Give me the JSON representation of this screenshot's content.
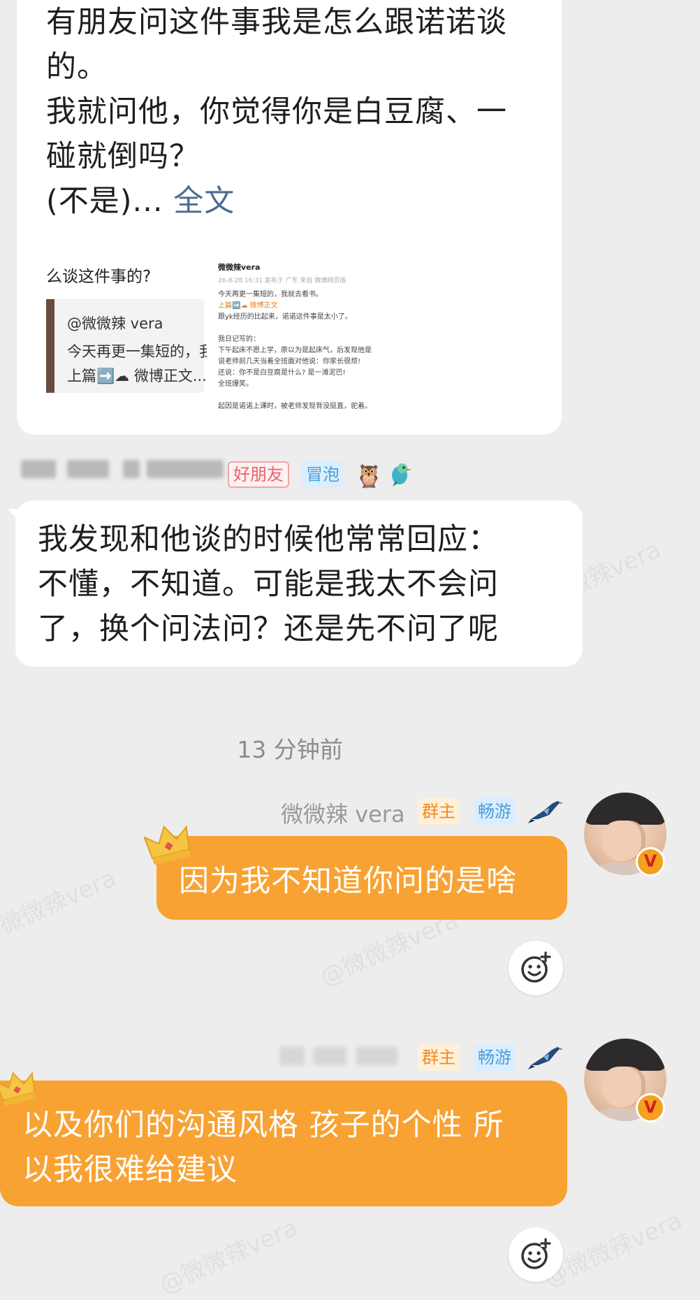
{
  "article_card": {
    "lines": [
      "有朋友问这件事我是怎么跟诺诺谈",
      "的。",
      "我就问他，你觉得你是白豆腐、一",
      "碰就倒吗？"
    ],
    "last_line_prefix": "(不是)... ",
    "full_text_link": "全文",
    "preview_left": {
      "title": "么谈这件事的?",
      "author": "@微微辣 vera",
      "snippet_1": "今天再更一集短的，我",
      "snippet_2": "上篇➡️☁ 微博正文..."
    },
    "preview_right": {
      "name": "微微辣vera",
      "meta": "26-8-28 16:31 发布于 广东 来自 微博网页版",
      "lines": [
        "今天再更一集短的，我就去看书。",
        "上篇➡️☁ 微博正文",
        "跟yk经历的比起来，诺诺这件事是太小了。",
        "",
        "我日记写的：",
        "下午起床不愿上学，原以为是起床气，后发现他是",
        "说老师前几天当着全班面对他说：你家长很烦!",
        "还说：你不是白豆腐是什么? 是一滩泥巴!",
        "全班爆笑。",
        "",
        "起因是诺诺上课时，被老师发现背没挺直，驼着。"
      ]
    }
  },
  "sender_row": {
    "friend_tag": "好朋友",
    "bubble_tag": "冒泡"
  },
  "message_left": {
    "lines": [
      "我发现和他谈的时候他常常回应：",
      "不懂，不知道。可能是我太不会问",
      "了，换个问法问？还是先不问了呢"
    ]
  },
  "timestamp": "13 分钟前",
  "message_right_1": {
    "sender": "微微辣 vera",
    "owner_tag": "群主",
    "swim_tag": "畅游",
    "text": "因为我不知道你问的是啥"
  },
  "message_right_2": {
    "owner_tag": "群主",
    "swim_tag": "畅游",
    "lines": [
      "以及你们的沟通风格 孩子的个性 所",
      "以我很难给建议"
    ]
  },
  "watermarks": [
    "@微微辣vera"
  ],
  "colors": {
    "background": "#ededed",
    "bubble_right": "#f8a233",
    "link": "#4d6a91",
    "owner_tag": "#ef8b21",
    "swim_tag": "#4a9fd8"
  }
}
